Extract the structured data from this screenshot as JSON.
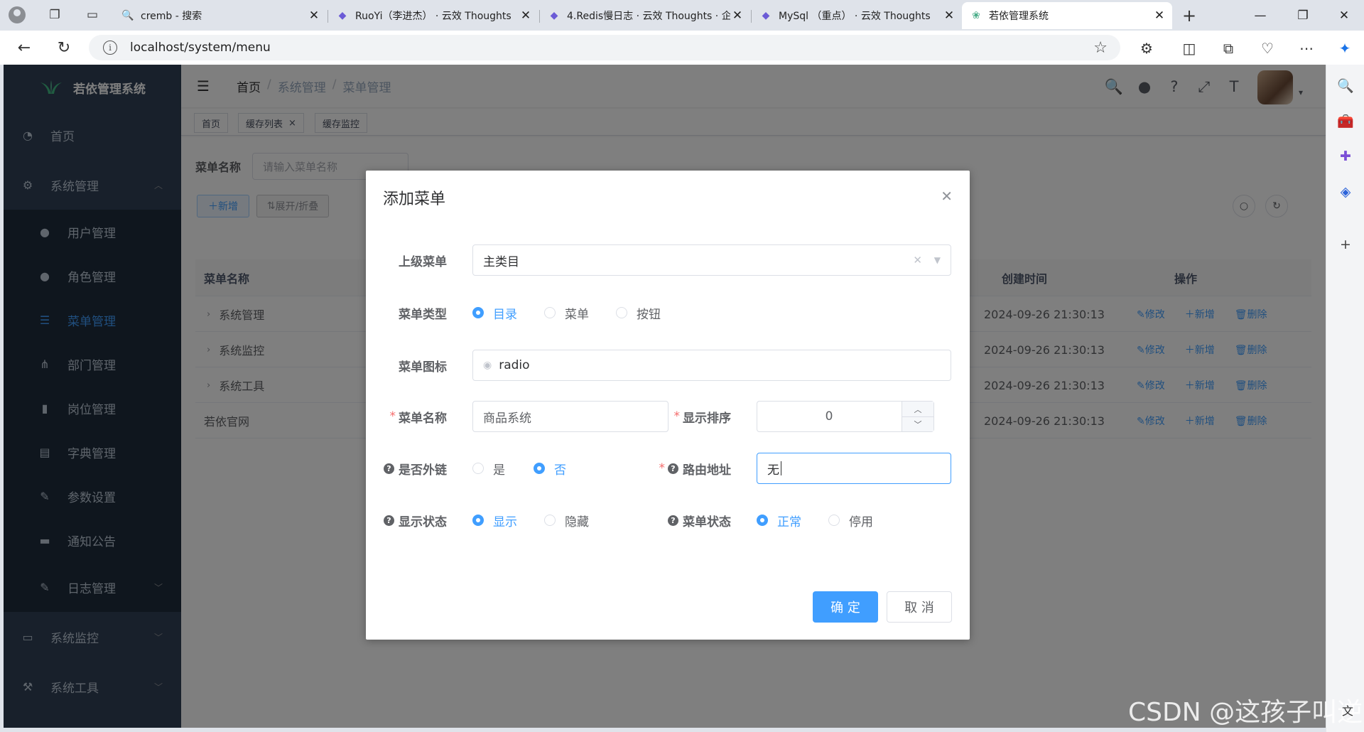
{
  "browser": {
    "tabs": [
      {
        "title": "cremb - 搜索",
        "icon": "search-icon"
      },
      {
        "title": "RuoYi（李进杰） · 云效 Thoughts",
        "icon": "thoughts-icon"
      },
      {
        "title": "4.Redis慢日志 · 云效 Thoughts · 企",
        "icon": "thoughts-icon"
      },
      {
        "title": "MySql （重点） · 云效 Thoughts",
        "icon": "thoughts-icon"
      },
      {
        "title": "若依管理系统",
        "icon": "ruoyi-logo-icon"
      }
    ],
    "url": "localhost/system/menu"
  },
  "sidebar": {
    "logo_text": "若依管理系统",
    "home": "首页",
    "system": "系统管理",
    "sub_items": [
      "用户管理",
      "角色管理",
      "菜单管理",
      "部门管理",
      "岗位管理",
      "字典管理",
      "参数设置",
      "通知公告",
      "日志管理"
    ],
    "monitor": "系统监控",
    "tools": "系统工具"
  },
  "navbar": {
    "breadcrumb": [
      "首页",
      "系统管理",
      "菜单管理"
    ]
  },
  "tags": [
    "首页",
    "缓存列表",
    "缓存监控"
  ],
  "tag_close": "×",
  "search": {
    "label": "菜单名称",
    "placeholder": "请输入菜单名称"
  },
  "toolbar": {
    "add": "新增",
    "expand": "展开/折叠"
  },
  "table": {
    "headers": {
      "name": "菜单名称",
      "created": "创建时间",
      "ops": "操作"
    },
    "rows": [
      {
        "name": "系统管理",
        "created": "2024-09-26 21:30:13",
        "expandable": true
      },
      {
        "name": "系统监控",
        "created": "2024-09-26 21:30:13",
        "expandable": true
      },
      {
        "name": "系统工具",
        "created": "2024-09-26 21:30:13",
        "expandable": true
      },
      {
        "name": "若依官网",
        "created": "2024-09-26 21:30:13",
        "expandable": false
      }
    ],
    "ops": {
      "edit": "修改",
      "add": "新增",
      "delete": "删除"
    }
  },
  "dialog": {
    "title": "添加菜单",
    "parent": {
      "label": "上级菜单",
      "value": "主类目"
    },
    "type": {
      "label": "菜单类型",
      "options": [
        "目录",
        "菜单",
        "按钮"
      ],
      "selected": "目录"
    },
    "icon": {
      "label": "菜单图标",
      "value": "radio"
    },
    "name": {
      "label": "菜单名称",
      "value": "商品系统"
    },
    "order": {
      "label": "显示排序",
      "value": "0"
    },
    "external": {
      "label": "是否外链",
      "options": [
        "是",
        "否"
      ],
      "selected": "否"
    },
    "path": {
      "label": "路由地址",
      "value": "无"
    },
    "visible": {
      "label": "显示状态",
      "options": [
        "显示",
        "隐藏"
      ],
      "selected": "显示"
    },
    "status": {
      "label": "菜单状态",
      "options": [
        "正常",
        "停用"
      ],
      "selected": "正常"
    },
    "confirm": "确 定",
    "cancel": "取 消"
  },
  "watermark": "CSDN @这孩子叫逆",
  "colors": {
    "primary": "#409eff",
    "sidebar": "#304156",
    "danger": "#f56c6c"
  }
}
